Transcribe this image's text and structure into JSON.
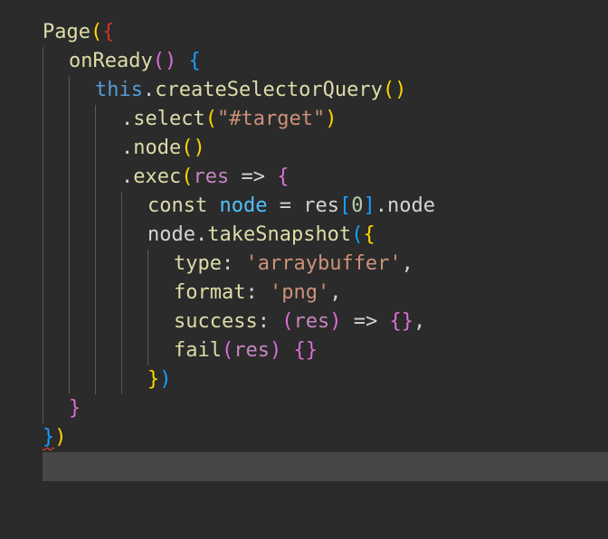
{
  "theme": {
    "background": "#2b2b2b",
    "default": "#d4d4d4",
    "guide": "#5a5a5a",
    "current_line": "#474747",
    "error_squiggle": "#f14c4c"
  },
  "lines": [
    {
      "indent": 0,
      "tokens": [
        {
          "t": "Page",
          "c": "#dcdcaa"
        },
        {
          "t": "(",
          "c": "#ffd700"
        },
        {
          "t": "{",
          "c": "#d0312d"
        }
      ]
    },
    {
      "indent": 1,
      "tokens": [
        {
          "t": "onReady",
          "c": "#dcdcaa"
        },
        {
          "t": "()",
          "c": "#da70d6"
        },
        {
          "t": " ",
          "c": "#d4d4d4"
        },
        {
          "t": "{",
          "c": "#179fff"
        }
      ]
    },
    {
      "indent": 2,
      "tokens": [
        {
          "t": "this",
          "c": "#569cd6"
        },
        {
          "t": ".",
          "c": "#d4d4d4"
        },
        {
          "t": "createSelectorQuery",
          "c": "#dcdcaa"
        },
        {
          "t": "()",
          "c": "#ffd700"
        }
      ]
    },
    {
      "indent": 3,
      "tokens": [
        {
          "t": ".",
          "c": "#d4d4d4"
        },
        {
          "t": "select",
          "c": "#dcdcaa"
        },
        {
          "t": "(",
          "c": "#ffd700"
        },
        {
          "t": "\"#target\"",
          "c": "#ce9178"
        },
        {
          "t": ")",
          "c": "#ffd700"
        }
      ]
    },
    {
      "indent": 3,
      "tokens": [
        {
          "t": ".",
          "c": "#d4d4d4"
        },
        {
          "t": "node",
          "c": "#dcdcaa"
        },
        {
          "t": "()",
          "c": "#ffd700"
        }
      ]
    },
    {
      "indent": 3,
      "tokens": [
        {
          "t": ".",
          "c": "#d4d4d4"
        },
        {
          "t": "exec",
          "c": "#dcdcaa"
        },
        {
          "t": "(",
          "c": "#ffd700"
        },
        {
          "t": "res",
          "c": "#c586c0"
        },
        {
          "t": " => ",
          "c": "#d4d4d4"
        },
        {
          "t": "{",
          "c": "#da70d6"
        }
      ]
    },
    {
      "indent": 4,
      "tokens": [
        {
          "t": "const",
          "c": "#dcdcaa"
        },
        {
          "t": " ",
          "c": "#d4d4d4"
        },
        {
          "t": "node",
          "c": "#4fc1ff"
        },
        {
          "t": " = ",
          "c": "#d4d4d4"
        },
        {
          "t": "res",
          "c": "#d4d4d4"
        },
        {
          "t": "[",
          "c": "#179fff"
        },
        {
          "t": "0",
          "c": "#b5cea8"
        },
        {
          "t": "]",
          "c": "#179fff"
        },
        {
          "t": ".node",
          "c": "#d4d4d4"
        }
      ]
    },
    {
      "indent": 4,
      "tokens": [
        {
          "t": "node",
          "c": "#d4d4d4"
        },
        {
          "t": ".",
          "c": "#d4d4d4"
        },
        {
          "t": "takeSnapshot",
          "c": "#dcdcaa"
        },
        {
          "t": "(",
          "c": "#179fff"
        },
        {
          "t": "{",
          "c": "#ffd700"
        }
      ]
    },
    {
      "indent": 5,
      "tokens": [
        {
          "t": "type",
          "c": "#dcdcaa"
        },
        {
          "t": ": ",
          "c": "#d4d4d4"
        },
        {
          "t": "'arraybuffer'",
          "c": "#ce9178"
        },
        {
          "t": ",",
          "c": "#d4d4d4"
        }
      ]
    },
    {
      "indent": 5,
      "tokens": [
        {
          "t": "format",
          "c": "#dcdcaa"
        },
        {
          "t": ": ",
          "c": "#d4d4d4"
        },
        {
          "t": "'png'",
          "c": "#ce9178"
        },
        {
          "t": ",",
          "c": "#d4d4d4"
        }
      ]
    },
    {
      "indent": 5,
      "tokens": [
        {
          "t": "success",
          "c": "#dcdcaa"
        },
        {
          "t": ": ",
          "c": "#d4d4d4"
        },
        {
          "t": "(",
          "c": "#da70d6"
        },
        {
          "t": "res",
          "c": "#c586c0"
        },
        {
          "t": ")",
          "c": "#da70d6"
        },
        {
          "t": " => ",
          "c": "#d4d4d4"
        },
        {
          "t": "{}",
          "c": "#da70d6"
        },
        {
          "t": ",",
          "c": "#d4d4d4"
        }
      ]
    },
    {
      "indent": 5,
      "tokens": [
        {
          "t": "fail",
          "c": "#dcdcaa"
        },
        {
          "t": "(",
          "c": "#da70d6"
        },
        {
          "t": "res",
          "c": "#c586c0"
        },
        {
          "t": ")",
          "c": "#da70d6"
        },
        {
          "t": " ",
          "c": "#d4d4d4"
        },
        {
          "t": "{}",
          "c": "#da70d6"
        }
      ]
    },
    {
      "indent": 4,
      "tokens": [
        {
          "t": "}",
          "c": "#ffd700"
        },
        {
          "t": ")",
          "c": "#179fff"
        }
      ]
    },
    {
      "indent": 1,
      "tokens": [
        {
          "t": "}",
          "c": "#da70d6"
        }
      ]
    },
    {
      "indent": 0,
      "tokens": [
        {
          "t": "}",
          "c": "#179fff",
          "err": true
        },
        {
          "t": ")",
          "c": "#ffd700"
        }
      ]
    }
  ]
}
